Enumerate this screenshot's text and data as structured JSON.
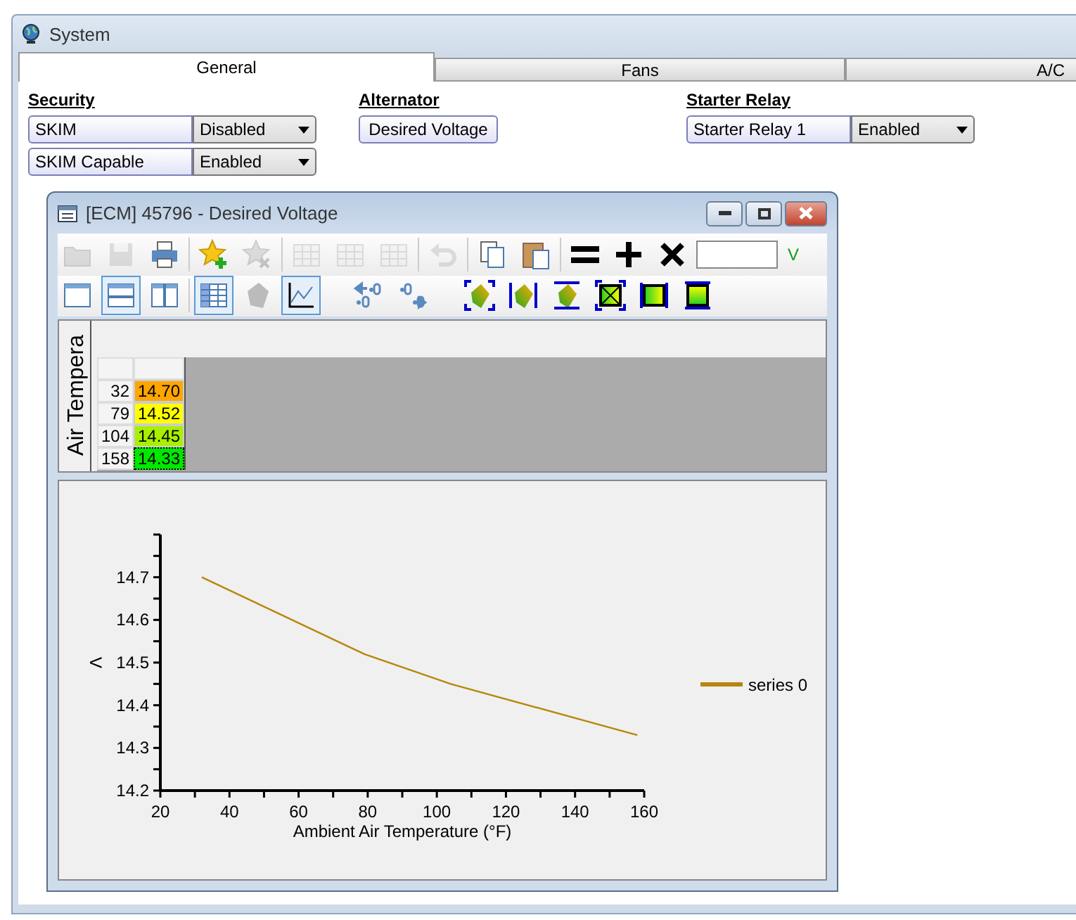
{
  "window": {
    "title": "System"
  },
  "tabs": [
    {
      "label": "General",
      "selected": true
    },
    {
      "label": "Fans",
      "selected": false
    },
    {
      "label": "A/C",
      "selected": false
    }
  ],
  "sections": [
    {
      "heading": "Security",
      "items": [
        {
          "kind": "select",
          "label": "SKIM",
          "value": "Disabled"
        },
        {
          "kind": "select",
          "label": "SKIM Capable",
          "value": "Enabled"
        }
      ]
    },
    {
      "heading": "Alternator",
      "items": [
        {
          "kind": "button",
          "label": "Desired Voltage"
        }
      ]
    },
    {
      "heading": "Starter Relay",
      "items": [
        {
          "kind": "select",
          "label": "Starter Relay 1",
          "value": "Enabled"
        }
      ]
    }
  ],
  "editor": {
    "title": "[ECM] 45796 - Desired Voltage",
    "toolbar": [
      {
        "kind": "open",
        "disabled": true
      },
      {
        "kind": "save",
        "disabled": true
      },
      {
        "kind": "print",
        "disabled": false
      },
      {
        "kind": "sep"
      },
      {
        "kind": "star-add",
        "disabled": false
      },
      {
        "kind": "star-remove",
        "disabled": true
      },
      {
        "kind": "sep"
      },
      {
        "kind": "grid",
        "disabled": true
      },
      {
        "kind": "grid",
        "disabled": true
      },
      {
        "kind": "grid",
        "disabled": true
      },
      {
        "kind": "sep"
      },
      {
        "kind": "undo",
        "disabled": true
      },
      {
        "kind": "sep"
      },
      {
        "kind": "copy",
        "disabled": false
      },
      {
        "kind": "paste",
        "disabled": false
      },
      {
        "kind": "sep"
      },
      {
        "kind": "equals",
        "disabled": false
      },
      {
        "kind": "plus",
        "disabled": false
      },
      {
        "kind": "times",
        "disabled": false
      }
    ],
    "unit": "V",
    "view_toolbar": [
      {
        "kind": "single",
        "pressed": false
      },
      {
        "kind": "hsplit",
        "pressed": true
      },
      {
        "kind": "vsplit",
        "pressed": false
      },
      {
        "kind": "sep"
      },
      {
        "kind": "table",
        "pressed": true
      },
      {
        "kind": "surface",
        "pressed": false
      },
      {
        "kind": "graph",
        "pressed": true
      },
      {
        "kind": "gap"
      },
      {
        "kind": "dec-left",
        "pressed": false
      },
      {
        "kind": "dec-right",
        "pressed": false
      },
      {
        "kind": "gap"
      },
      {
        "kind": "fit-all",
        "pressed": false
      },
      {
        "kind": "fit-x",
        "pressed": false
      },
      {
        "kind": "fit-y",
        "pressed": false
      },
      {
        "kind": "box-x",
        "pressed": false
      },
      {
        "kind": "box-v",
        "pressed": false
      },
      {
        "kind": "box-h",
        "pressed": false
      }
    ],
    "axis_label": "Air Tempera",
    "rows": [
      {
        "axis": "32",
        "value": "14.70",
        "color": "#ffa500",
        "selected": false
      },
      {
        "axis": "79",
        "value": "14.52",
        "color": "#ffff00",
        "selected": false
      },
      {
        "axis": "104",
        "value": "14.45",
        "color": "#a8f000",
        "selected": false
      },
      {
        "axis": "158",
        "value": "14.33",
        "color": "#00e800",
        "selected": true
      }
    ],
    "chart_data": {
      "type": "line",
      "xlabel": "Ambient Air Temperature (°F)",
      "ylabel": "V",
      "x": [
        32,
        79,
        104,
        158
      ],
      "series": [
        {
          "name": "series 0",
          "color": "#b8860b",
          "values": [
            14.7,
            14.52,
            14.45,
            14.33
          ]
        }
      ],
      "xlim": [
        20,
        160
      ],
      "ylim": [
        14.2,
        14.8
      ],
      "xticks": [
        20,
        40,
        60,
        80,
        100,
        120,
        140,
        160
      ],
      "yticks": [
        14.2,
        14.3,
        14.4,
        14.5,
        14.6,
        14.7
      ]
    }
  }
}
